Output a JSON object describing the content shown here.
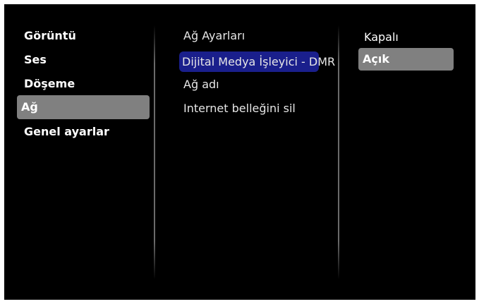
{
  "menu": {
    "left": [
      {
        "label": "Görüntü"
      },
      {
        "label": "Ses"
      },
      {
        "label": "Döşeme"
      },
      {
        "label": "Ağ"
      },
      {
        "label": "Genel ayarlar"
      }
    ],
    "middle": [
      {
        "label": "Ağ Ayarları"
      },
      {
        "label": "Dijital Medya İşleyici - DMR"
      },
      {
        "label": "Ağ adı"
      },
      {
        "label": "Internet belleğini sil"
      }
    ],
    "right": [
      {
        "label": "Kapalı"
      },
      {
        "label": "Açık"
      }
    ]
  },
  "colors": {
    "background": "#000000",
    "highlight_grey": "#808080",
    "highlight_blue": "#1a1f8c"
  }
}
